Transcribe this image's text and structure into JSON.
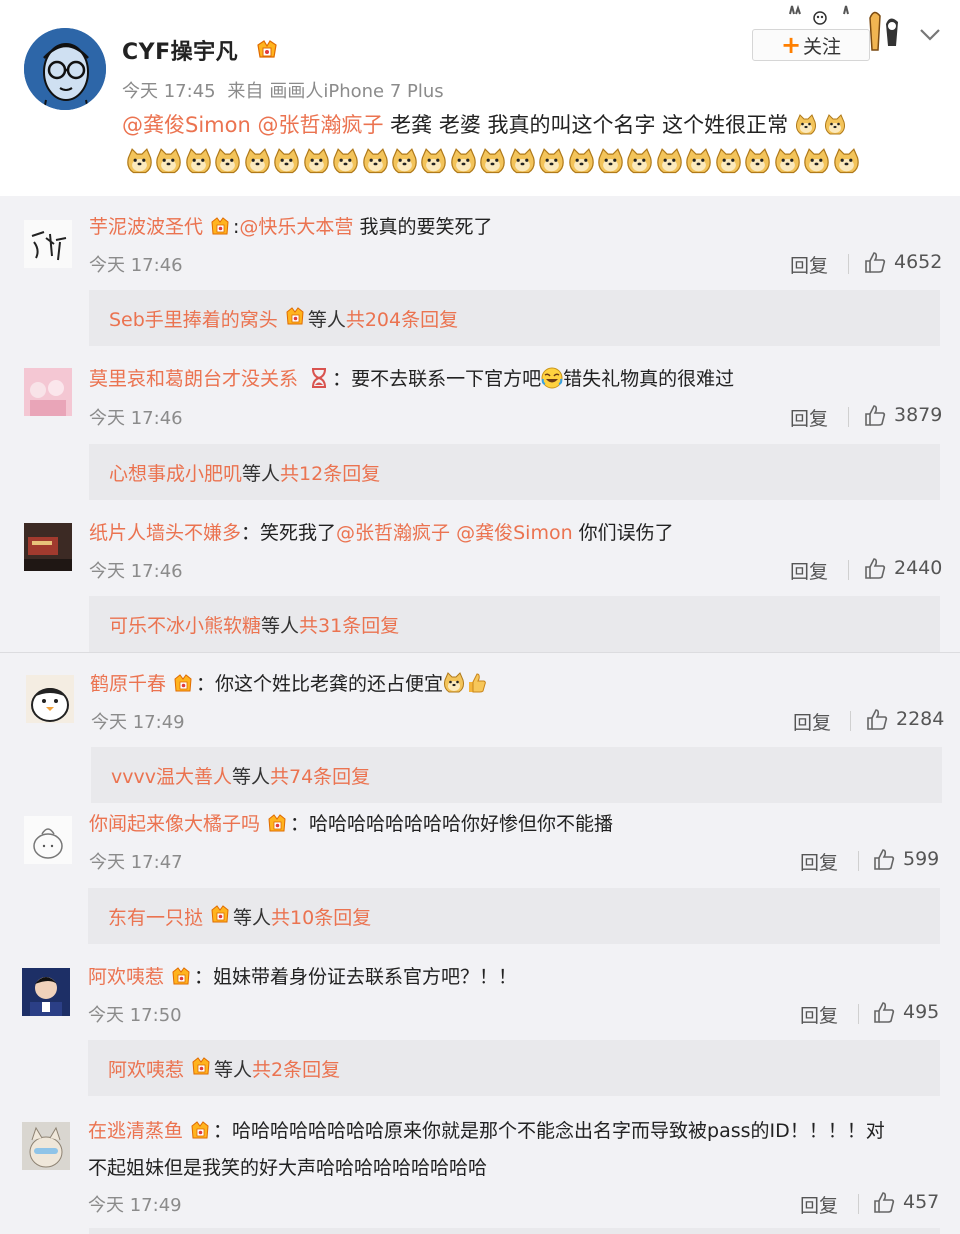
{
  "post": {
    "author": "CYF操宇凡",
    "time": "今天 17:45",
    "source_prefix": "来自",
    "source": "画画人iPhone 7 Plus",
    "follow_label": "关注",
    "mention1": "@龚俊Simon",
    "mention2": "@张哲瀚疯子",
    "text": " 老龚 老婆 我真的叫这个名字 这个姓很正常",
    "emoji_count_line2": 25,
    "icons": [
      "avatar-glasses-drawing",
      "weibo-vip-badge",
      "plus-icon",
      "bear-stickers-decoration",
      "chevron-down-icon",
      "doge-emoji"
    ]
  },
  "colors": {
    "link": "#eb7350",
    "follow_plus": "#ff7f00",
    "muted": "#8b8b8b",
    "panel": "#e9e9ec"
  },
  "comments": [
    {
      "name": "芋泥波波圣代",
      "badge": true,
      "colon": ":",
      "mention": "@快乐大本营",
      "text": " 我真的要笑死了",
      "time": "今天 17:46",
      "reply_label": "回复",
      "likes": "4652",
      "sub_user": "Seb手里捧着的窝头",
      "sub_badge": true,
      "sub_mid": " 等人 ",
      "sub_count": "共204条回复"
    },
    {
      "name": "莫里哀和葛朗台才没关系",
      "badge": false,
      "colon": "：",
      "text_before": "要不去联系一下官方吧",
      "text_after": "错失礼物真的很难过",
      "time": "今天 17:46",
      "reply_label": "回复",
      "likes": "3879",
      "sub_user": "心想事成小肥叽",
      "sub_mid": " 等人 ",
      "sub_count": "共12条回复"
    },
    {
      "name": "纸片人墙头不嫌多",
      "colon": "：",
      "text_before": "笑死我了",
      "mention1": "@张哲瀚疯子",
      "mention2": " @龚俊Simon",
      "text_after": " 你们误伤了",
      "time": "今天 17:46",
      "reply_label": "回复",
      "likes": "2440",
      "sub_user": "可乐不冰小熊软糖",
      "sub_mid": " 等人 ",
      "sub_count": "共31条回复"
    },
    {
      "name": "鹤原千春",
      "colon": "：",
      "text": "你这个姓比老龚的还占便宜",
      "time": "今天 17:49",
      "reply_label": "回复",
      "likes": "2284",
      "sub_user": "vvvv温大善人",
      "sub_mid": " 等人 ",
      "sub_count": "共74条回复"
    },
    {
      "name": "你闻起来像大橘子吗",
      "colon": "：",
      "text": "哈哈哈哈哈哈哈哈你好惨但你不能播",
      "time": "今天 17:47",
      "reply_label": "回复",
      "likes": "599",
      "sub_user": "东有一只挞",
      "sub_mid": " 等人 ",
      "sub_count": "共10条回复"
    },
    {
      "name": "阿欢咦惹",
      "colon": "：",
      "text": "姐妹带着身份证去联系官方吧？！！",
      "time": "今天 17:50",
      "reply_label": "回复",
      "likes": "495",
      "sub_user": "阿欢咦惹",
      "sub_mid": " 等人 ",
      "sub_count": "共2条回复"
    },
    {
      "name": "在逃清蒸鱼",
      "colon": "：",
      "text_line1": "哈哈哈哈哈哈哈哈原来你就是那个不能念出名字而导致被pass的ID！！！！对",
      "text_line2": "不起姐妹但是我笑的好大声哈哈哈哈哈哈哈哈哈",
      "time": "今天 17:49",
      "reply_label": "回复",
      "likes": "457"
    }
  ]
}
